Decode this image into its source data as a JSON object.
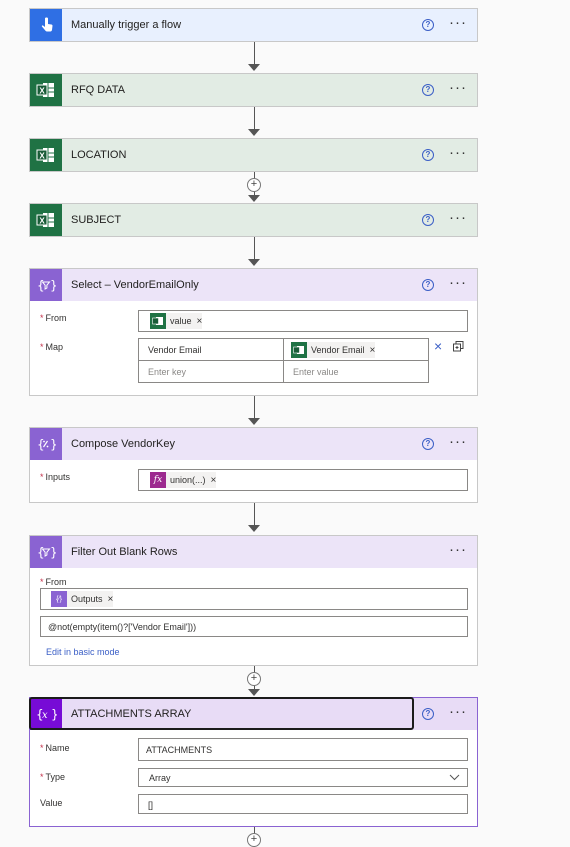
{
  "cards": {
    "trigger": {
      "title": "Manually trigger a flow",
      "help": "?",
      "more": "···"
    },
    "rfq": {
      "title": "RFQ DATA",
      "help": "?",
      "more": "···"
    },
    "location": {
      "title": "LOCATION",
      "help": "?",
      "more": "···"
    },
    "subject": {
      "title": "SUBJECT",
      "help": "?",
      "more": "···"
    },
    "select": {
      "title": "Select – VendorEmailOnly",
      "help": "?",
      "more": "···",
      "from_label": "From",
      "from_token": "value",
      "map_label": "Map",
      "map_key": "Vendor Email",
      "map_value_token": "Vendor Email",
      "key_placeholder": "Enter key",
      "value_placeholder": "Enter value"
    },
    "compose": {
      "title": "Compose VendorKey",
      "help": "?",
      "more": "···",
      "inputs_label": "Inputs",
      "inputs_token": "union(...)"
    },
    "filter": {
      "title": "Filter Out Blank Rows",
      "more": "···",
      "from_label": "From",
      "from_token": "Outputs",
      "expression": "@not(empty(item()?['Vendor Email']))",
      "edit_link": "Edit in basic mode"
    },
    "attachments": {
      "title": "ATTACHMENTS ARRAY",
      "help": "?",
      "more": "···",
      "name_label": "Name",
      "name_value": "ATTACHMENTS",
      "type_label": "Type",
      "type_value": "Array",
      "value_label": "Value",
      "value_value": "[]"
    }
  },
  "required_mark": "*",
  "token_remove": "×",
  "add_step": "+",
  "colors": {
    "trigger_header": "#e8f0fe",
    "trigger_icon": "#2f6fe4",
    "excel_header": "#e2ece4",
    "excel_icon": "#1f7244",
    "data_header": "#ece4f8",
    "data_icon": "#8a63d2",
    "var_header": "#e8dcf6",
    "var_icon": "#770bd6"
  },
  "icons": [
    "touch-icon",
    "excel-icon",
    "data-operation-icon",
    "compose-icon",
    "variable-icon",
    "help-icon",
    "more-icon",
    "close-icon",
    "copy-icon",
    "chevron-down-icon",
    "add-icon",
    "fx-icon"
  ]
}
